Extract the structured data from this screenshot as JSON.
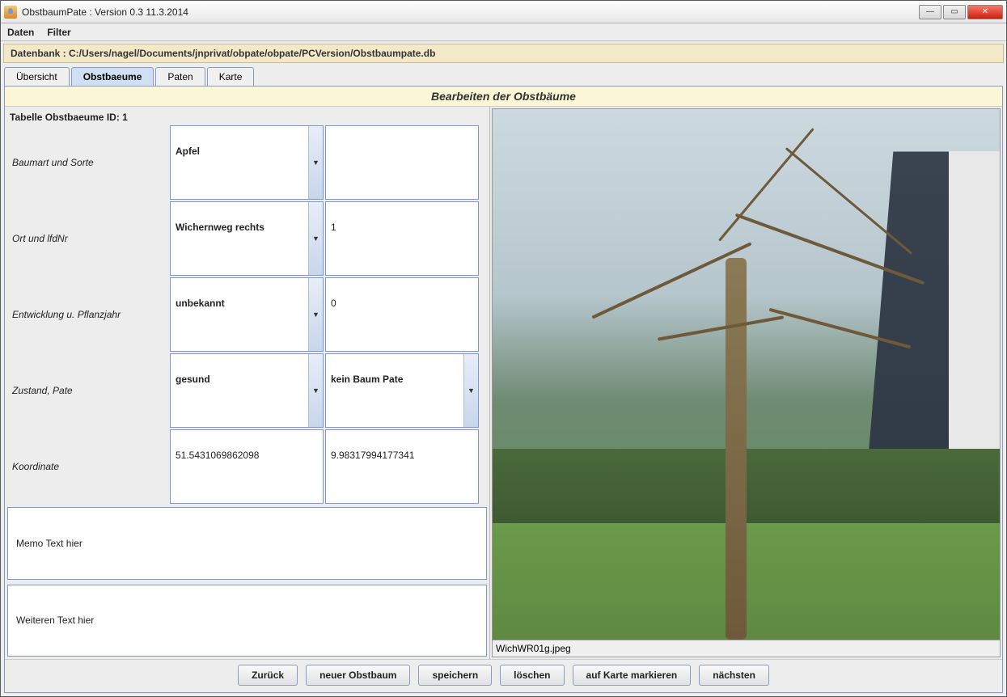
{
  "window": {
    "title": "ObstbaumPate : Version 0.3 11.3.2014"
  },
  "menu": {
    "daten": "Daten",
    "filter": "Filter"
  },
  "dbpath": "Datenbank : C:/Users/nagel/Documents/jnprivat/obpate/obpate/PCVersion/Obstbaumpate.db",
  "tabs": {
    "uebersicht": "Übersicht",
    "obstbaeume": "Obstbaeume",
    "paten": "Paten",
    "karte": "Karte"
  },
  "section_title": "Bearbeiten der Obstbäume",
  "table_id_label": "Tabelle Obstbaeume ID: 1",
  "rows": {
    "baumart": {
      "label": "Baumart und Sorte",
      "v1": "Apfel",
      "v2": ""
    },
    "ort": {
      "label": "Ort und lfdNr",
      "v1": "Wichernweg rechts",
      "v2": "1"
    },
    "entwicklung": {
      "label": "Entwicklung u. Pflanzjahr",
      "v1": "unbekannt",
      "v2": "0"
    },
    "zustand": {
      "label": "Zustand, Pate",
      "v1": "gesund",
      "v2": "kein Baum Pate"
    },
    "koord": {
      "label": "Koordinate",
      "v1": "51.5431069862098",
      "v2": "9.98317994177341"
    }
  },
  "memo1": "Memo Text hier",
  "memo2": "Weiteren Text hier",
  "image_caption": "WichWR01g.jpeg",
  "buttons": {
    "zurueck": "Zurück",
    "neu": "neuer Obstbaum",
    "speichern": "speichern",
    "loeschen": "löschen",
    "markieren": "auf Karte markieren",
    "naechsten": "nächsten"
  }
}
